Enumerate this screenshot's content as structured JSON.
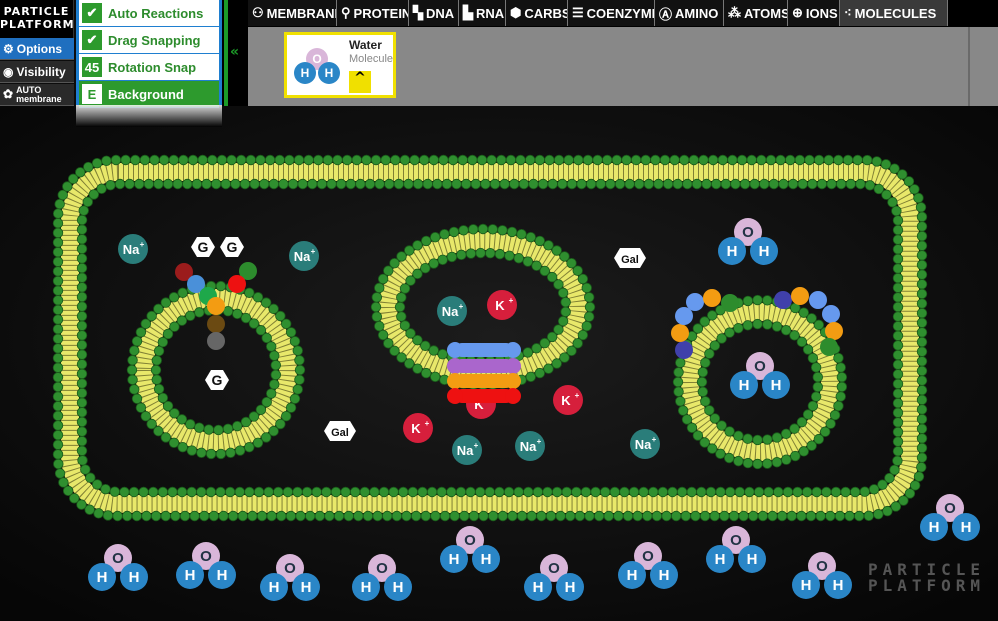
{
  "logo": {
    "line1": "PARTICLE",
    "line2": "PLATFORM"
  },
  "sidebar": [
    {
      "label": "Options",
      "icon": "gear-icon",
      "active": true
    },
    {
      "label": "Visibility",
      "icon": "eye-icon",
      "active": false
    },
    {
      "label1": "AUTO",
      "label2": "membrane",
      "icon": "membrane-icon",
      "active": false
    }
  ],
  "options_menu": [
    {
      "label": "Auto Reactions",
      "mark": "✔"
    },
    {
      "label": "Drag Snapping",
      "mark": "✔"
    },
    {
      "label": "Rotation Snap",
      "mark": "45"
    },
    {
      "label": "Background",
      "mark": "E"
    }
  ],
  "collapse_glyph": "«",
  "tabs": [
    {
      "label": "MEMBRANE",
      "icon": "membrane-icon"
    },
    {
      "label": "PROTEINS",
      "icon": "protein-icon"
    },
    {
      "label": "DNA",
      "icon": "dna-icon"
    },
    {
      "label": "RNA",
      "icon": "rna-icon"
    },
    {
      "label": "CARBS",
      "icon": "carbs-icon"
    },
    {
      "label": "COENZYME",
      "icon": "coenzyme-icon"
    },
    {
      "label": "AMINO",
      "icon": "amino-icon"
    },
    {
      "label": "ATOMS",
      "icon": "atoms-icon"
    },
    {
      "label": "IONS",
      "icon": "ions-icon"
    },
    {
      "label": "MOLECULES",
      "icon": "molecules-icon",
      "active": true
    }
  ],
  "selected_molecule": {
    "name": "Water",
    "type": "Molecule",
    "up_glyph": "^"
  },
  "atoms": {
    "O": "O",
    "H": "H",
    "Na": "Na",
    "K": "K",
    "G": "G",
    "Gal": "Gal",
    "plus": "+"
  },
  "watermark": {
    "line1": "PARTICLE",
    "line2": "PLATFORM"
  },
  "colors": {
    "water_o": "#d9b6d9",
    "water_h": "#2a86c7",
    "sodium": "#2a7d7a",
    "potassium": "#d61f3c",
    "membrane_head": "#2f8f2f",
    "membrane_tail": "#e8e86a",
    "selection": "#f0e000"
  }
}
